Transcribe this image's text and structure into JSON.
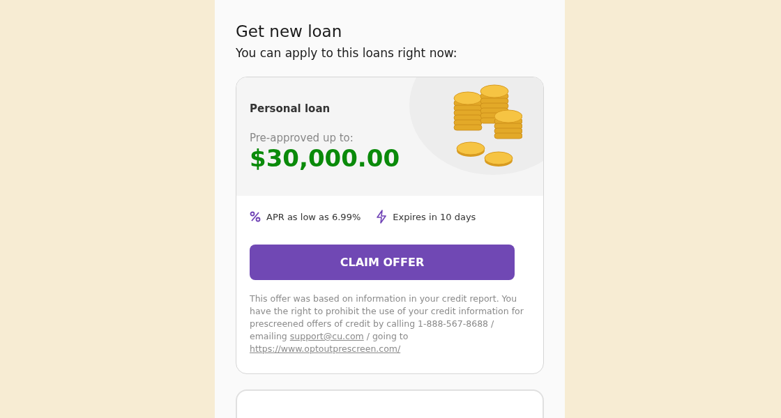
{
  "title": "Get new loan",
  "subtitle": "You can apply to this loans right now:",
  "offer": {
    "name": "Personal loan",
    "amount_label": "Pre-approved up to:",
    "amount": "$30,000.00",
    "features": [
      {
        "kind": "percent",
        "text": "APR as low as 6.99%"
      },
      {
        "kind": "bolt",
        "text": "Expires in 10 days"
      }
    ],
    "button": "CLAIM OFFER",
    "disclaimer": {
      "before": "This offer was based on information in your credit report. You have the right to prohibit the use of your credit information for prescreened offers of credit by calling 1-888-567-8688 / emailing ",
      "email": "support@cu.com",
      "middle": " / going to ",
      "url": "https://www.optoutprescreen.com/"
    }
  }
}
